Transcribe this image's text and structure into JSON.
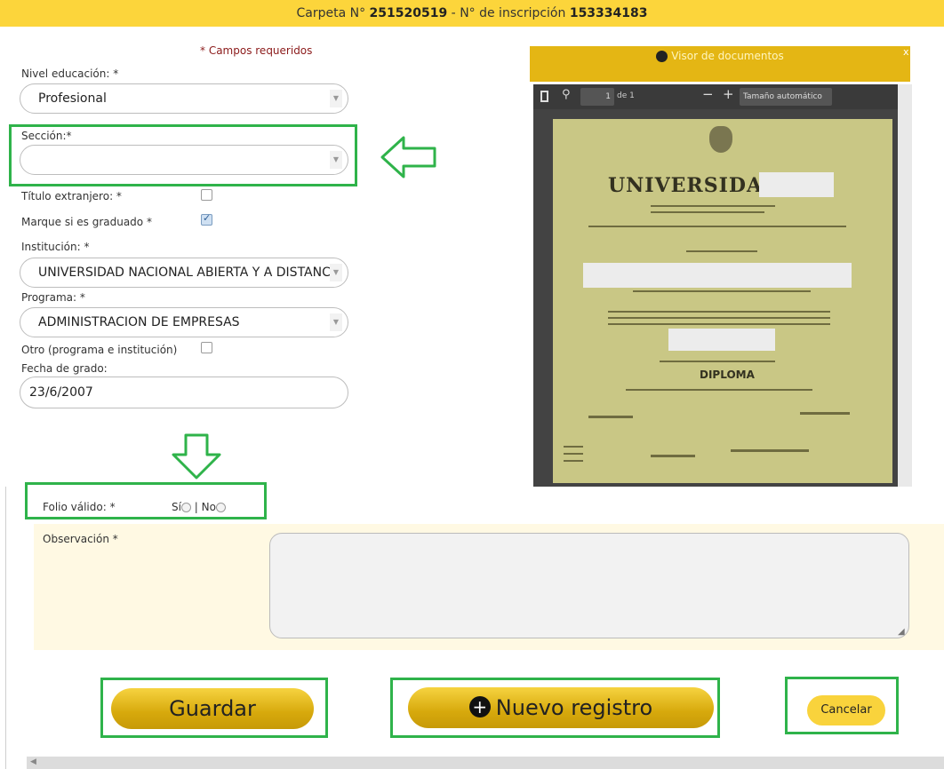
{
  "header": {
    "carpeta_label": "Carpeta N°",
    "carpeta_value": "251520519",
    "separator": "-",
    "inscripcion_label": "N° de inscripción",
    "inscripcion_value": "153334183"
  },
  "form": {
    "required_note": "* Campos requeridos",
    "nivel_label": "Nivel educación: *",
    "nivel_value": "Profesional",
    "seccion_label": "Sección:*",
    "seccion_value": "",
    "titulo_label": "Título extranjero: *",
    "titulo_checked": false,
    "graduado_label": "Marque si es graduado *",
    "graduado_checked": true,
    "institucion_label": "Institución: *",
    "institucion_value": "UNIVERSIDAD NACIONAL ABIERTA Y A DISTANCIA",
    "programa_label": "Programa: *",
    "programa_value": "ADMINISTRACION DE EMPRESAS",
    "otro_label": "Otro (programa e institución)",
    "otro_checked": false,
    "fecha_label": "Fecha de grado:",
    "fecha_value": "23/6/2007"
  },
  "viewer": {
    "title": "Visor de documentos",
    "close": "x",
    "page_value": "1",
    "page_of": "de 1",
    "zoom_minus": "−",
    "zoom_plus": "+",
    "zoom_value": "Tamaño automático",
    "document": {
      "university": "UNIVERSIDAD DE",
      "diploma": "DIPLOMA"
    }
  },
  "folio": {
    "label": "Folio válido: *",
    "yes": "Sí",
    "sep": "|",
    "no": "No"
  },
  "observacion": {
    "label": "Observación *",
    "value": ""
  },
  "buttons": {
    "guardar": "Guardar",
    "nuevo": "Nuevo registro",
    "cancelar": "Cancelar"
  },
  "colors": {
    "accent": "#fcd53b",
    "highlight": "#2fb34a",
    "required": "#8b1a1a"
  }
}
